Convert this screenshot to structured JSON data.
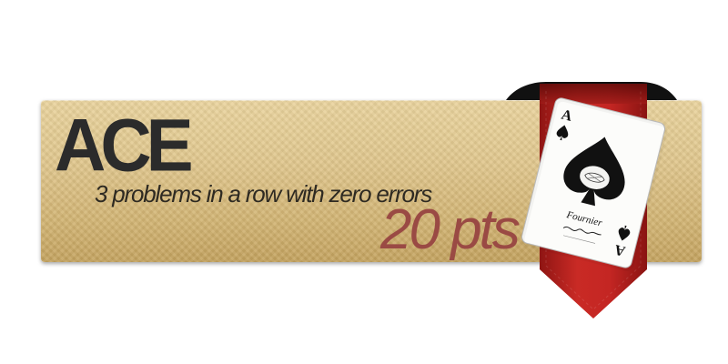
{
  "achievement": {
    "title": "ACE",
    "description": "3 problems in a row with zero errors",
    "points": "20 pts"
  },
  "card": {
    "rank": "A",
    "suit": "spade",
    "brand": "Fournier"
  },
  "colors": {
    "plate": "#d9bd7f",
    "title": "#2b2b2b",
    "points": "#9a4a44",
    "ribbon": "#b8221f"
  }
}
